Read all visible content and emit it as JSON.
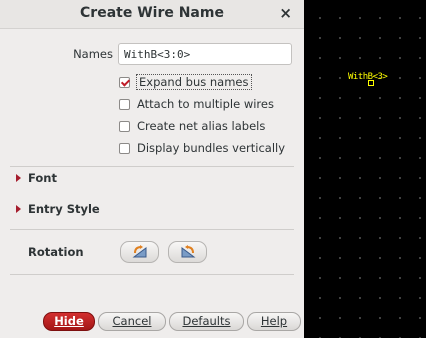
{
  "dialog": {
    "title": "Create Wire Name",
    "close_glyph": "×",
    "names_label": "Names",
    "names_value": "WithB<3:0>",
    "options": [
      {
        "label": "Expand bus names",
        "checked": true
      },
      {
        "label": "Attach to multiple wires",
        "checked": false
      },
      {
        "label": "Create net alias labels",
        "checked": false
      },
      {
        "label": "Display bundles vertically",
        "checked": false
      }
    ],
    "font_label": "Font",
    "entry_style_label": "Entry Style",
    "rotation_label": "Rotation",
    "buttons": {
      "hide": "Hide",
      "cancel": "Cancel",
      "defaults": "Defaults",
      "help": "Help"
    }
  },
  "canvas": {
    "wire_label": "WithB<3>"
  },
  "colors": {
    "accent": "#c01c28",
    "wire": "#ffff00",
    "canvas_bg": "#000000"
  }
}
